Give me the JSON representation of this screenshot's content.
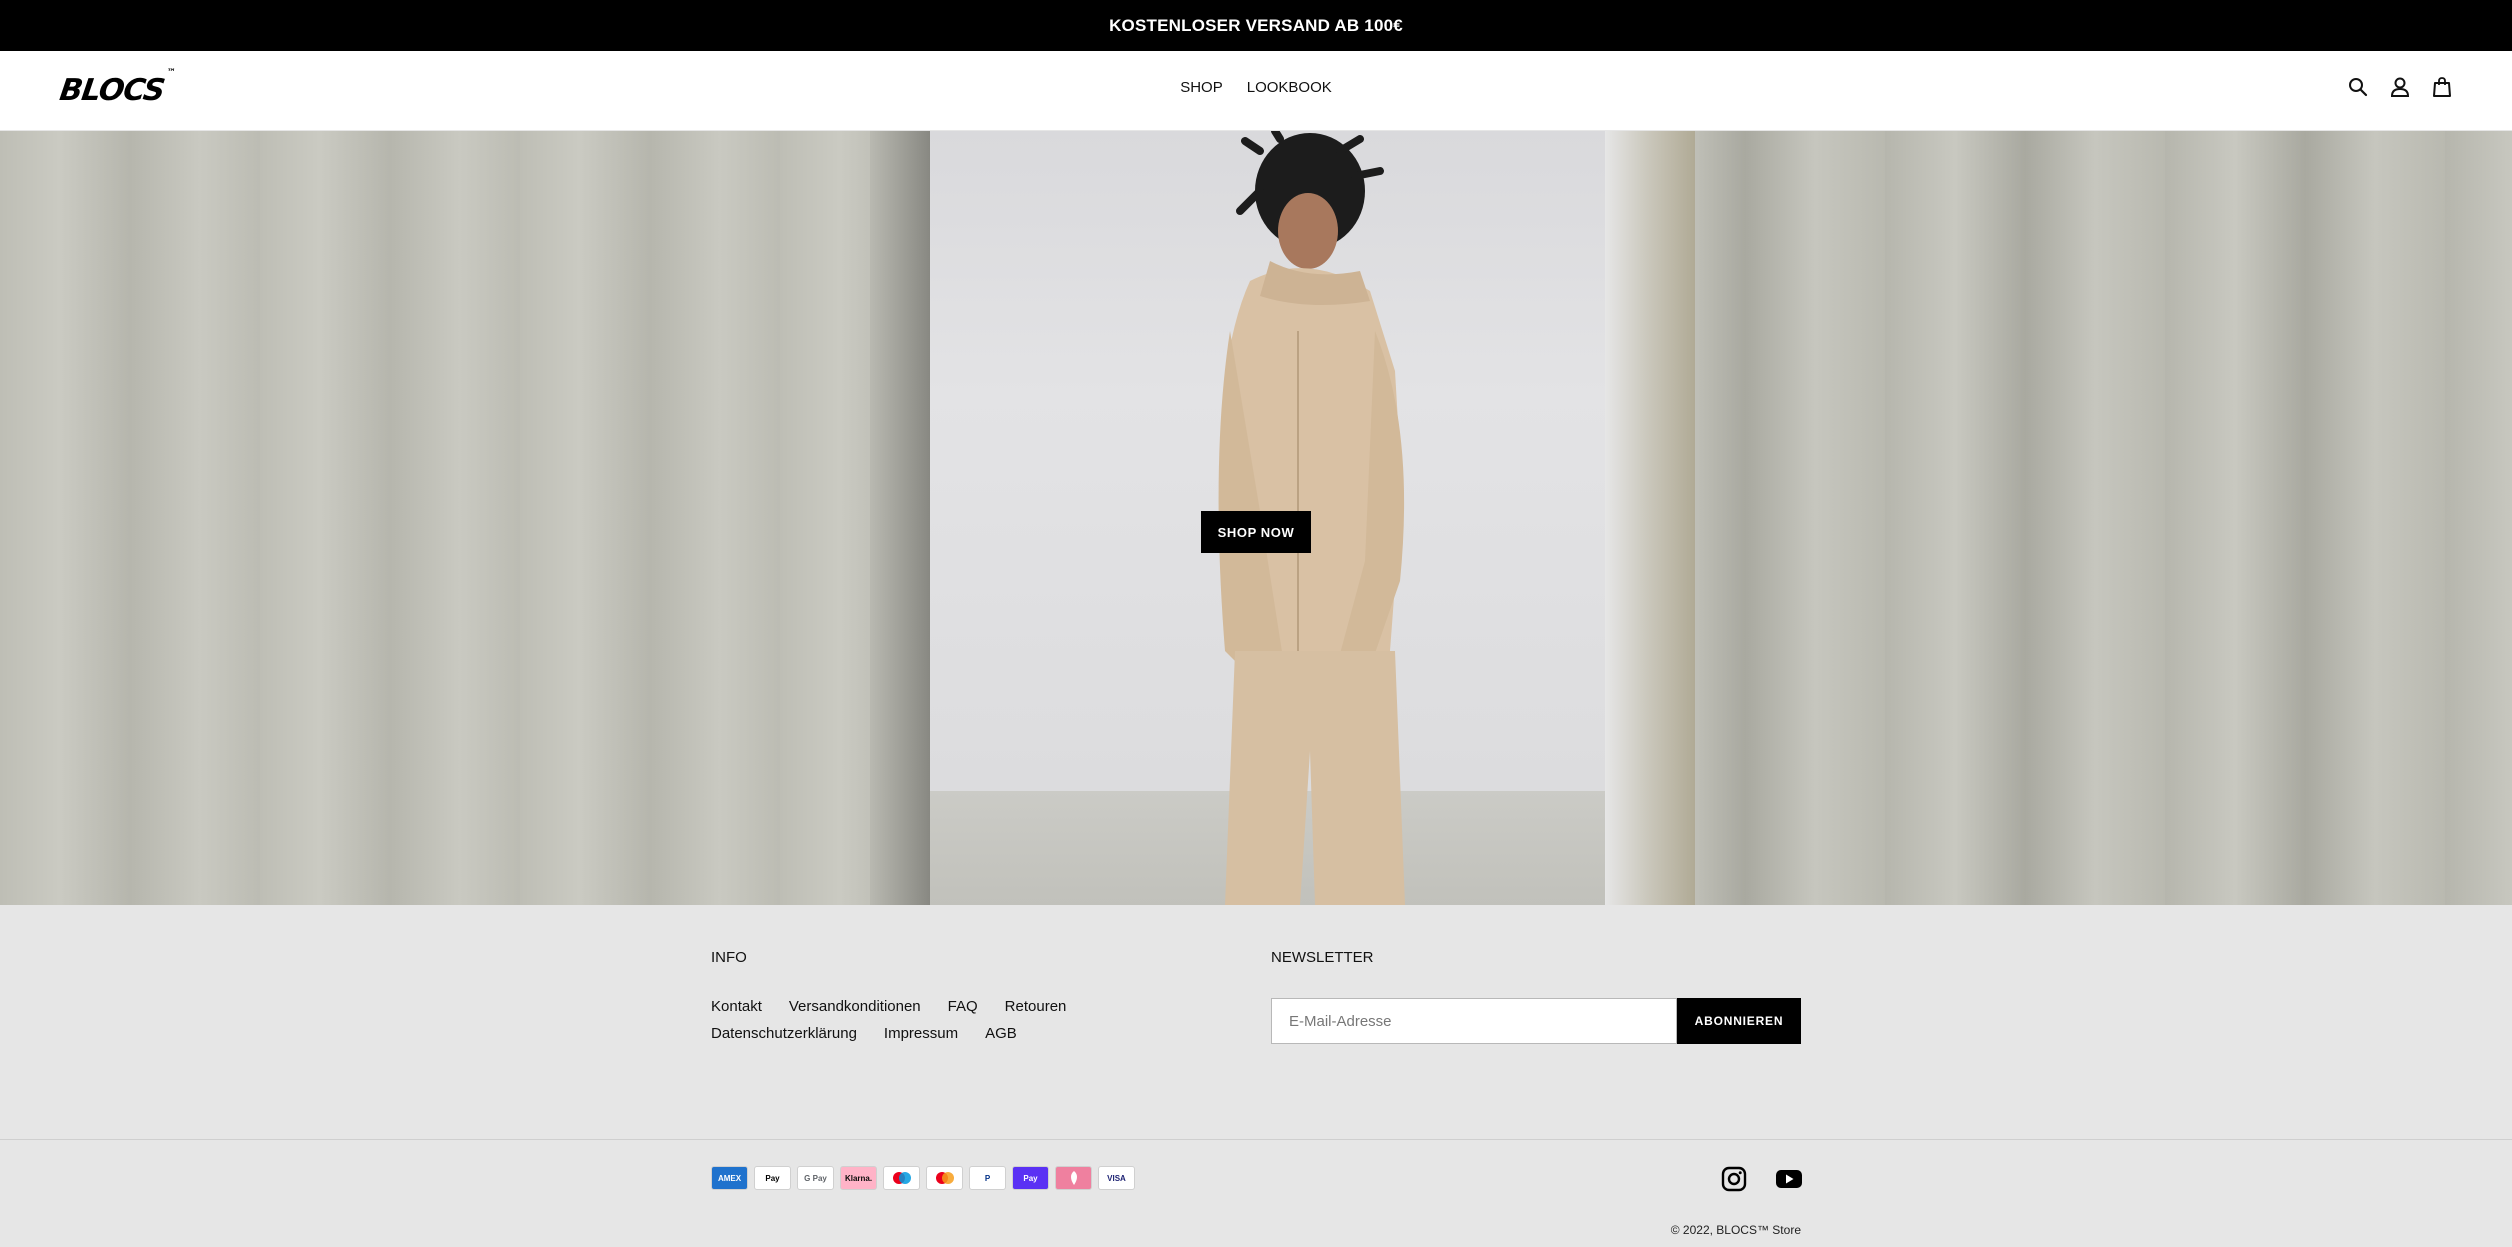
{
  "announcement": {
    "text": "KOSTENLOSER VERSAND AB 100€"
  },
  "header": {
    "logo": "BLOCS",
    "logo_tm": "™",
    "nav": [
      {
        "label": "SHOP"
      },
      {
        "label": "LOOKBOOK"
      }
    ],
    "icons": [
      "search-icon",
      "account-icon",
      "cart-icon"
    ]
  },
  "hero": {
    "cta_label": "SHOP NOW"
  },
  "footer": {
    "info": {
      "title": "INFO",
      "links": [
        "Kontakt",
        "Versandkonditionen",
        "FAQ",
        "Retouren",
        "Datenschutzerklärung",
        "Impressum",
        "AGB"
      ]
    },
    "newsletter": {
      "title": "NEWSLETTER",
      "email_placeholder": "E-Mail-Adresse",
      "subscribe_label": "ABONNIEREN"
    },
    "payments": [
      {
        "name": "amex-icon",
        "label": "AMEX",
        "bg": "#1f72cd",
        "fg": "#ffffff"
      },
      {
        "name": "apple-pay-icon",
        "label": "Pay",
        "bg": "#ffffff",
        "fg": "#000000"
      },
      {
        "name": "google-pay-icon",
        "label": "G Pay",
        "bg": "#ffffff",
        "fg": "#5f6368"
      },
      {
        "name": "klarna-icon",
        "label": "Klarna.",
        "bg": "#ffb3c7",
        "fg": "#0a0b09"
      },
      {
        "name": "maestro-icon",
        "label": "",
        "bg": "#ffffff",
        "fg": "#000000"
      },
      {
        "name": "mastercard-icon",
        "label": "",
        "bg": "#ffffff",
        "fg": "#000000"
      },
      {
        "name": "paypal-icon",
        "label": "P",
        "bg": "#ffffff",
        "fg": "#003087"
      },
      {
        "name": "shop-pay-icon",
        "label": "Pay",
        "bg": "#5a31f4",
        "fg": "#ffffff"
      },
      {
        "name": "sofort-icon",
        "label": "",
        "bg": "#ef809f",
        "fg": "#ffffff"
      },
      {
        "name": "visa-icon",
        "label": "VISA",
        "bg": "#ffffff",
        "fg": "#1a1f71"
      }
    ],
    "socials": [
      "instagram-icon",
      "youtube-icon"
    ],
    "copyright": "© 2022, BLOCS™ Store"
  },
  "colors": {
    "announcement_bg": "#000000",
    "footer_bg": "#e6e6e6",
    "button_bg": "#000000"
  }
}
